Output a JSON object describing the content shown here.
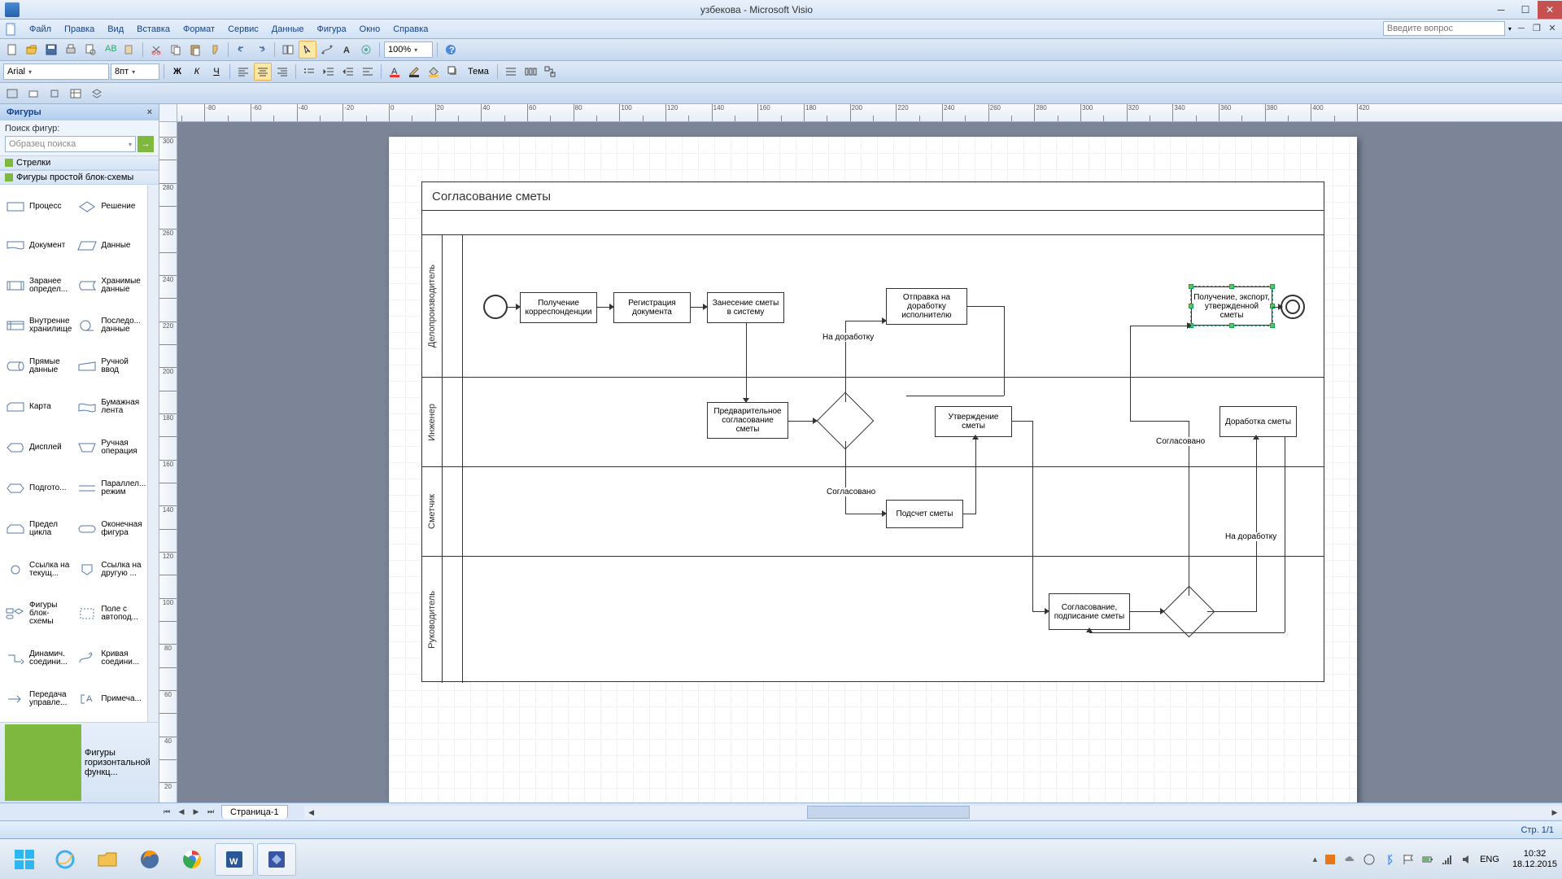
{
  "window": {
    "title": "узбекова - Microsoft Visio"
  },
  "menu": {
    "items": [
      "Файл",
      "Правка",
      "Вид",
      "Вставка",
      "Формат",
      "Сервис",
      "Данные",
      "Фигура",
      "Окно",
      "Справка"
    ],
    "help_placeholder": "Введите вопрос"
  },
  "toolbar1": {
    "zoom": "100%"
  },
  "toolbar2": {
    "font": "Arial",
    "size": "8пт",
    "theme_label": "Тема"
  },
  "shapes": {
    "title": "Фигуры",
    "search_label": "Поиск фигур:",
    "search_placeholder": "Образец поиска",
    "categories": [
      "Стрелки",
      "Фигуры простой блок-схемы"
    ],
    "footer_cat": "Фигуры горизонтальной функц...",
    "items": [
      {
        "label": "Процесс"
      },
      {
        "label": "Решение"
      },
      {
        "label": "Документ"
      },
      {
        "label": "Данные"
      },
      {
        "label": "Заранее определ..."
      },
      {
        "label": "Хранимые данные"
      },
      {
        "label": "Внутренне хранилище"
      },
      {
        "label": "Последо... данные"
      },
      {
        "label": "Прямые данные"
      },
      {
        "label": "Ручной ввод"
      },
      {
        "label": "Карта"
      },
      {
        "label": "Бумажная лента"
      },
      {
        "label": "Дисплей"
      },
      {
        "label": "Ручная операция"
      },
      {
        "label": "Подгото..."
      },
      {
        "label": "Параллел... режим"
      },
      {
        "label": "Предел цикла"
      },
      {
        "label": "Оконечная фигура"
      },
      {
        "label": "Ссылка на текущ..."
      },
      {
        "label": "Ссылка на другую ..."
      },
      {
        "label": "Фигуры блок-схемы"
      },
      {
        "label": "Поле с автопод..."
      },
      {
        "label": "Динамич. соедини..."
      },
      {
        "label": "Кривая соедини..."
      },
      {
        "label": "Передача управле..."
      },
      {
        "label": "Примеча..."
      }
    ]
  },
  "canvas": {
    "diagram_title": "Согласование сметы",
    "lanes": [
      "Делопроизводитель",
      "Инженер",
      "Сметчик",
      "Руководитель"
    ],
    "boxes": {
      "b1": "Получение корреспонденции",
      "b2": "Регистрация документа",
      "b3": "Занесение сметы в систему",
      "b4": "Отправка на доработку исполнителю",
      "b5": "Получение, экспорт, утвержденной сметы",
      "b6": "Предварительное согласование сметы",
      "b7": "Утверждение сметы",
      "b8": "Доработка сметы",
      "b9": "Подсчет сметы",
      "b10": "Согласование, подписание сметы"
    },
    "labels": {
      "l1": "На доработку",
      "l2": "Согласовано",
      "l3": "Согласовано",
      "l4": "На доработку"
    }
  },
  "tabs": {
    "page1": "Страница-1"
  },
  "status": {
    "page": "Стр. 1/1"
  },
  "taskbar": {
    "lang": "ENG",
    "time": "10:32",
    "date": "18.12.2015"
  }
}
